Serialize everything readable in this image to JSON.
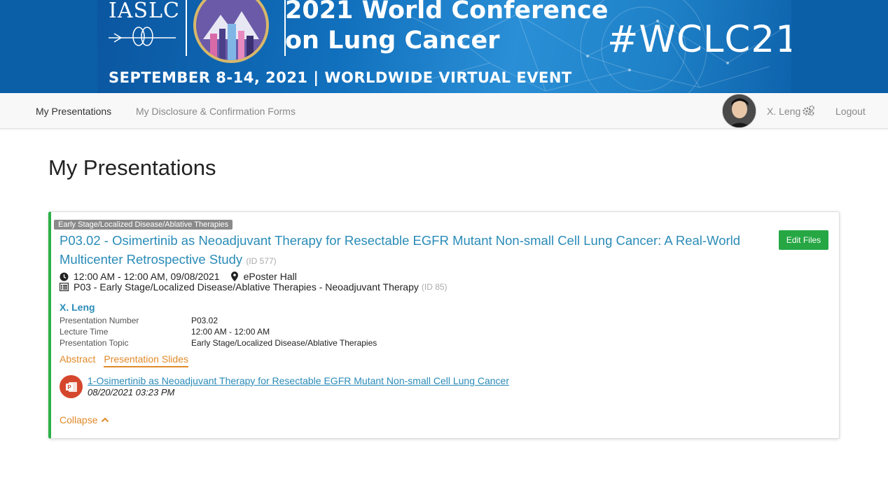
{
  "banner": {
    "org": "IASLC",
    "title_line1": "2021 World Conference",
    "title_line2": "on Lung Cancer",
    "hashtag": "#WCLC21",
    "subtitle": "SEPTEMBER 8-14, 2021 | WORLDWIDE VIRTUAL EVENT"
  },
  "nav": {
    "my_presentations": "My Presentations",
    "disclosure_forms": "My Disclosure & Confirmation Forms",
    "user_name": "X. Leng",
    "logout": "Logout"
  },
  "page": {
    "title": "My Presentations"
  },
  "presentation": {
    "topic_badge": "Early Stage/Localized Disease/Ablative Therapies",
    "title": "P03.02 - Osimertinib as Neoadjuvant Therapy for Resectable EGFR Mutant Non-small Cell Lung Cancer: A Real-World Multicenter Retrospective Study",
    "id_label": "(ID 577)",
    "edit_button": "Edit Files",
    "time": "12:00 AM - 12:00 AM, 09/08/2021",
    "location": "ePoster Hall",
    "session": "P03 - Early Stage/Localized Disease/Ablative Therapies - Neoadjuvant Therapy",
    "session_id": "(ID 85)",
    "author": "X. Leng",
    "details": [
      {
        "key": "Presentation Number",
        "value": "P03.02"
      },
      {
        "key": "Lecture Time",
        "value": "12:00 AM - 12:00 AM"
      },
      {
        "key": "Presentation Topic",
        "value": "Early Stage/Localized Disease/Ablative Therapies"
      }
    ],
    "tabs": [
      "Abstract",
      "Presentation Slides"
    ],
    "active_tab": "Presentation Slides",
    "file": {
      "name": "1-Osimertinib as Neoadjuvant Therapy for Resectable EGFR Mutant Non-small Cell Lung Cancer",
      "date": "08/20/2021 03:23 PM"
    },
    "collapse_label": "Collapse"
  },
  "colors": {
    "accent_blue": "#2a8bb8",
    "accent_orange": "#e08a2a",
    "green": "#26a744"
  }
}
